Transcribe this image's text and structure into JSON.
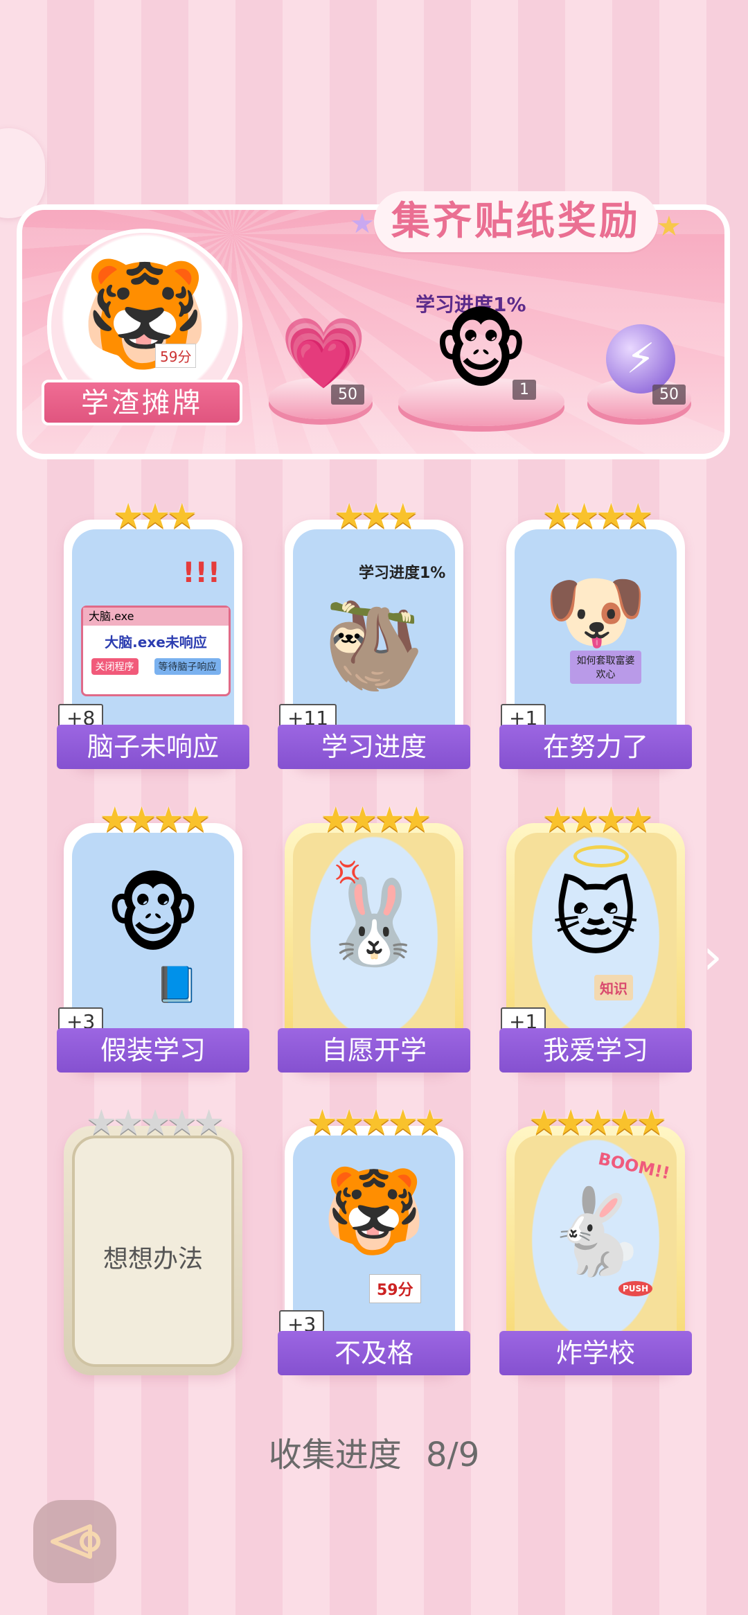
{
  "banner": {
    "title": "集齐贴纸奖励",
    "rank_label": "学渣摊牌",
    "tiger_score": "59分",
    "progress_text": "学习进度1%",
    "rewards": [
      {
        "icon": "heart-gem-icon",
        "count": "50"
      },
      {
        "icon": "monkey-reader-icon",
        "count": "1"
      },
      {
        "icon": "lightning-orb-icon",
        "count": "50"
      }
    ]
  },
  "cards": [
    {
      "label": "脑子未响应",
      "badge": "+8",
      "stars": 3,
      "window_title": "大脑.exe",
      "window_msg": "大脑.exe未响应",
      "btn_close": "关闭程序",
      "btn_wait": "等待脑子响应"
    },
    {
      "label": "学习进度",
      "badge": "+11",
      "stars": 3,
      "caption": "学习进度1%"
    },
    {
      "label": "在努力了",
      "badge": "+1",
      "stars": 4,
      "book_text": "如何套取富婆欢心"
    },
    {
      "label": "假装学习",
      "badge": "+3",
      "stars": 4
    },
    {
      "label": "自愿开学",
      "stars": 4
    },
    {
      "label": "我爱学习",
      "badge": "+1",
      "stars": 4,
      "book_text": "知识"
    },
    {
      "label": "想想办法",
      "stars": 5,
      "locked": true
    },
    {
      "label": "不及格",
      "badge": "+3",
      "stars": 5,
      "paper_text": "59分"
    },
    {
      "label": "炸学校",
      "stars": 5,
      "boom_text": "BOOM!!",
      "push_text": "PUSH"
    }
  ],
  "collect": {
    "label": "收集进度",
    "value": "8/9"
  }
}
